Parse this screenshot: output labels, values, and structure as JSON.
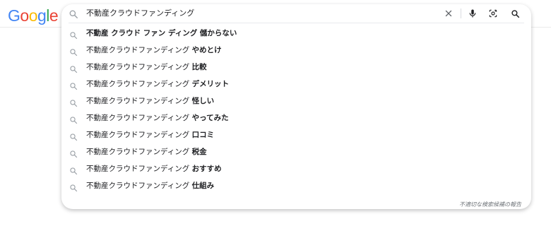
{
  "logo": {
    "letters": [
      "G",
      "o",
      "o",
      "g",
      "l",
      "e"
    ],
    "colors": [
      "#4285F4",
      "#EA4335",
      "#FBBC05",
      "#4285F4",
      "#34A853",
      "#EA4335"
    ]
  },
  "search": {
    "query": "不動産クラウドファンディング"
  },
  "icons": {
    "search": "search-icon",
    "clear": "close-icon",
    "voice": "microphone-icon",
    "lens": "camera-lens-icon",
    "submit": "search-icon"
  },
  "suggestions": [
    {
      "base": "不動産 クラウド ファン ディング 儲からない",
      "bold": ""
    },
    {
      "base": "不動産クラウドファンディング ",
      "bold": "やめとけ"
    },
    {
      "base": "不動産クラウドファンディング ",
      "bold": "比較"
    },
    {
      "base": "不動産クラウドファンディング ",
      "bold": "デメリット"
    },
    {
      "base": "不動産クラウドファンディング ",
      "bold": "怪しい"
    },
    {
      "base": "不動産クラウドファンディング ",
      "bold": "やってみた"
    },
    {
      "base": "不動産クラウドファンディング ",
      "bold": "口コミ"
    },
    {
      "base": "不動産クラウドファンディング ",
      "bold": "税金"
    },
    {
      "base": "不動産クラウドファンディング ",
      "bold": "おすすめ"
    },
    {
      "base": "不動産クラウドファンディング ",
      "bold": "仕組み"
    }
  ],
  "report_link": "不適切な検索候補の報告"
}
